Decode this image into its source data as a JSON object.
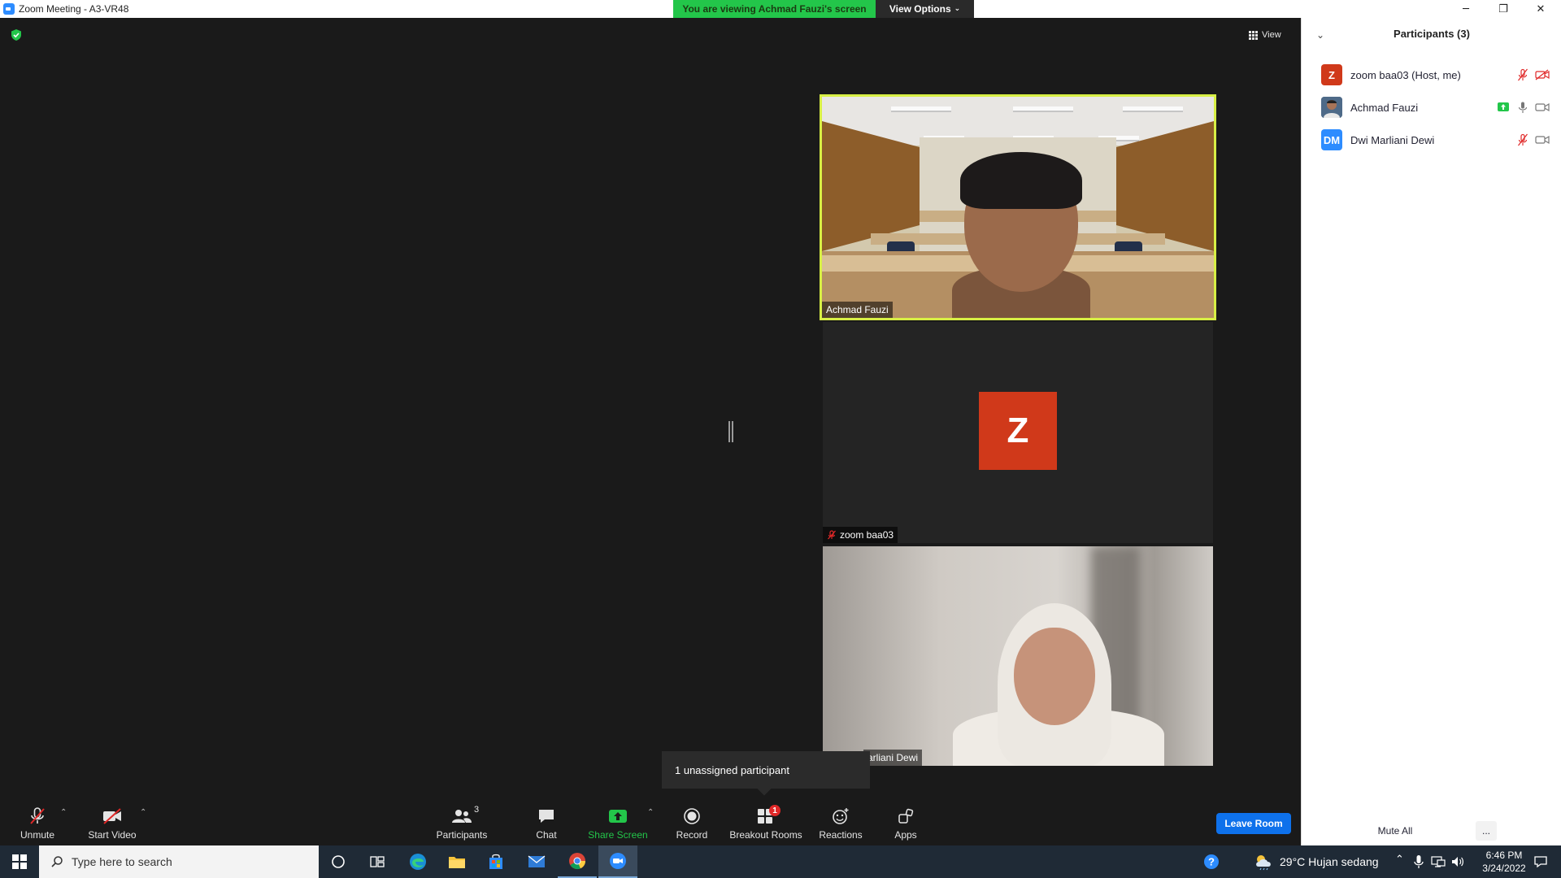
{
  "window": {
    "title": "Zoom Meeting - A3-VR48",
    "viewing_banner": "You are viewing Achmad Fauzi's screen",
    "view_options_label": "View Options",
    "view_button_label": "View"
  },
  "videos": {
    "tile1_name": "Achmad Fauzi",
    "tile2_name": "zoom baa03",
    "tile2_avatar_letter": "Z",
    "tile3_name": "arliani Dewi"
  },
  "tooltip": "1 unassigned participant",
  "toolbar": {
    "unmute": "Unmute",
    "start_video": "Start Video",
    "participants": "Participants",
    "participants_count": "3",
    "chat": "Chat",
    "share_screen": "Share Screen",
    "record": "Record",
    "breakout_rooms": "Breakout Rooms",
    "breakout_badge": "1",
    "reactions": "Reactions",
    "apps": "Apps",
    "leave_room": "Leave Room"
  },
  "panel": {
    "title": "Participants (3)",
    "participants": [
      {
        "initials": "Z",
        "name": "zoom baa03 (Host, me)",
        "color": "#d0391a"
      },
      {
        "initials": "",
        "name": "Achmad Fauzi",
        "color": "#3a5a7a"
      },
      {
        "initials": "DM",
        "name": "Dwi Marliani Dewi",
        "color": "#2d8cff"
      }
    ],
    "mute_all": "Mute All",
    "more": "..."
  },
  "taskbar": {
    "search_placeholder": "Type here to search",
    "weather": "29°C  Hujan sedang",
    "time": "6:46 PM",
    "date": "3/24/2022"
  },
  "colors": {
    "accent": "#2d8cff",
    "banner_green": "#23c64a",
    "speaker_border": "#d8ef45",
    "leave_blue": "#0e71eb",
    "muted_red": "#e02828"
  }
}
